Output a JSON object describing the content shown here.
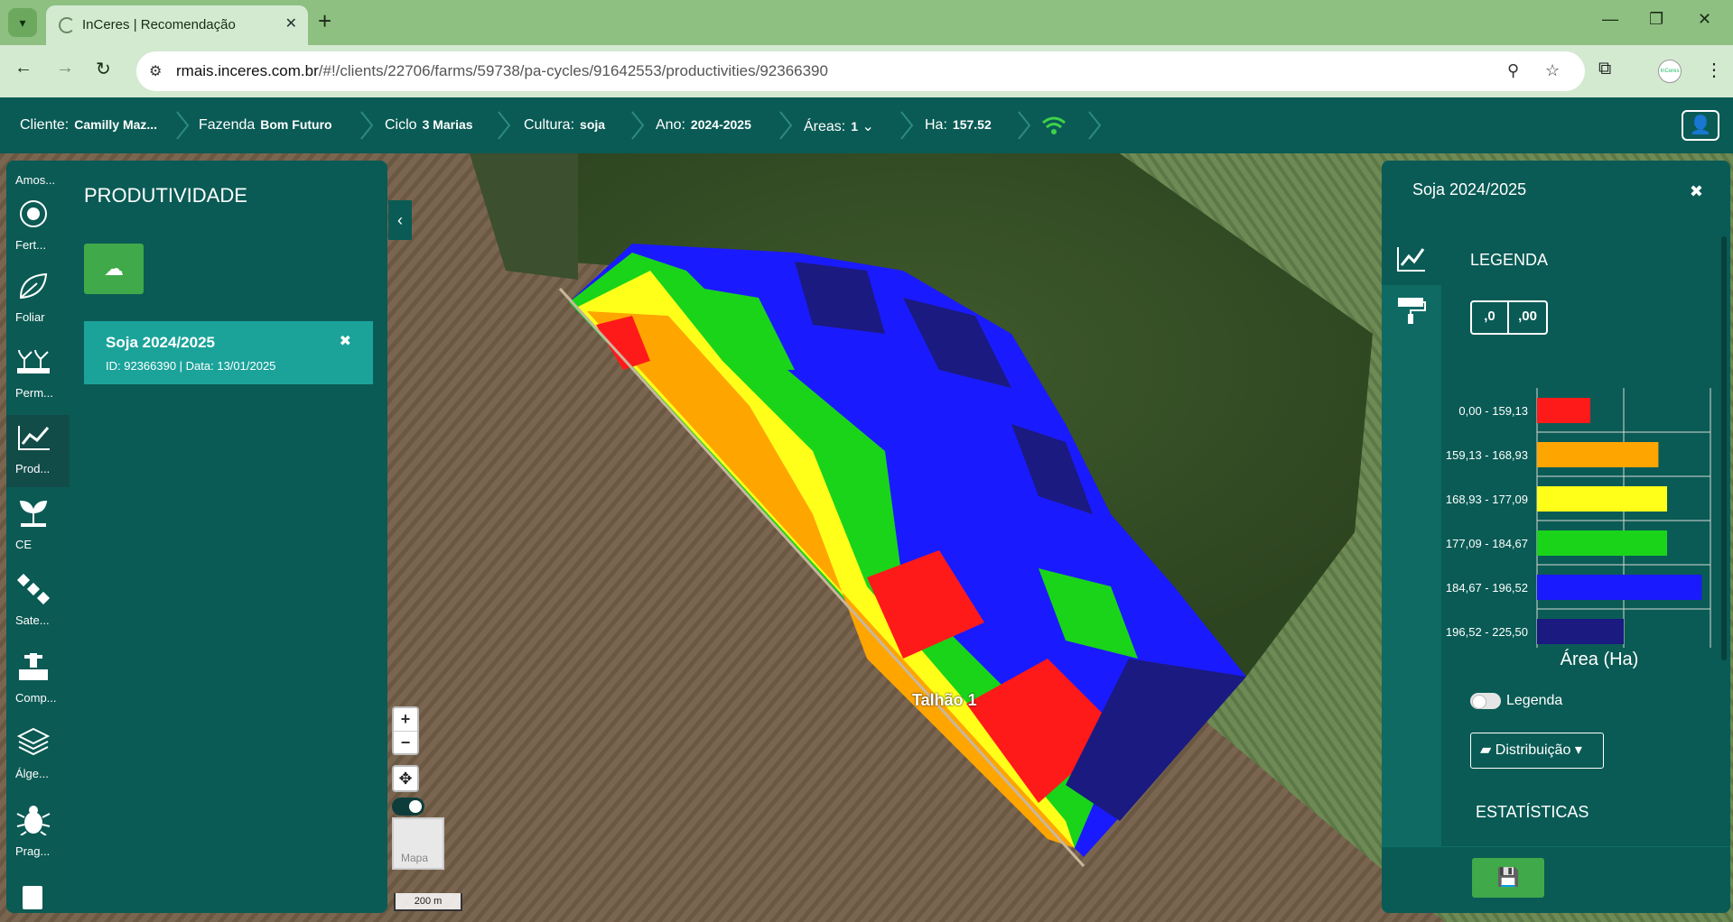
{
  "browser": {
    "tab_title": "InCeres | Recomendação",
    "url_host": "rmais.inceres.com.br",
    "url_path": "/#!/clients/22706/farms/59738/pa-cycles/91642553/productivities/92366390"
  },
  "appbar": {
    "cliente_label": "Cliente:",
    "cliente_value": "Camilly Maz...",
    "fazenda_label": "Fazenda",
    "fazenda_value": "Bom Futuro",
    "ciclo_label": "Ciclo",
    "ciclo_value": "3 Marias",
    "cultura_label": "Cultura:",
    "cultura_value": "soja",
    "ano_label": "Ano:",
    "ano_value": "2024-2025",
    "areas_label": "Áreas:",
    "areas_value": "1",
    "ha_label": "Ha:",
    "ha_value": "157.52"
  },
  "rail": {
    "items": [
      {
        "label": "Amos...",
        "icon": "sample-icon"
      },
      {
        "label": "Fert...",
        "icon": "fertilizer-icon"
      },
      {
        "label": "Foliar",
        "icon": "leaf-icon"
      },
      {
        "label": "Perm...",
        "icon": "plants-icon"
      },
      {
        "label": "Prod...",
        "icon": "chart-line-icon",
        "active": true
      },
      {
        "label": "CE",
        "icon": "sprout-icon"
      },
      {
        "label": "Sate...",
        "icon": "satellite-icon"
      },
      {
        "label": "Comp...",
        "icon": "soil-icon"
      },
      {
        "label": "Álge...",
        "icon": "layers-icon"
      },
      {
        "label": "Prag...",
        "icon": "bug-icon"
      }
    ]
  },
  "left_panel": {
    "title": "PRODUTIVIDADE",
    "card_title": "Soja 2024/2025",
    "card_subtitle": "ID: 92366390 | Data: 13/01/2025"
  },
  "map": {
    "field_label": "Talhão 1",
    "thumb_label": "Mapa",
    "scale_label": "200 m"
  },
  "right_panel": {
    "title": "Soja 2024/2025",
    "legend_title": "LEGENDA",
    "dec_less": ",0",
    "dec_more": ",00",
    "area_title": "Área (Ha)",
    "legend_toggle_label": "Legenda",
    "dist_label": "Distribuição",
    "stats_title": "ESTATÍSTICAS"
  },
  "chart_data": {
    "type": "bar",
    "orientation": "horizontal",
    "categories": [
      "0,00 - 159,13",
      "159,13 - 168,93",
      "168,93 - 177,09",
      "177,09 - 184,67",
      "184,67 - 196,52",
      "196,52 - 225,50"
    ],
    "values": [
      12.3,
      28,
      30,
      30,
      38,
      20
    ],
    "colors": [
      "#ff1a1a",
      "#ffa500",
      "#ffff1a",
      "#1ad41a",
      "#1a1aff",
      "#1a1a80"
    ],
    "xlabel": "Área (Ha)",
    "xlim": [
      0,
      40
    ],
    "xticks": [
      "0",
      "20",
      "40"
    ],
    "grid": true
  }
}
